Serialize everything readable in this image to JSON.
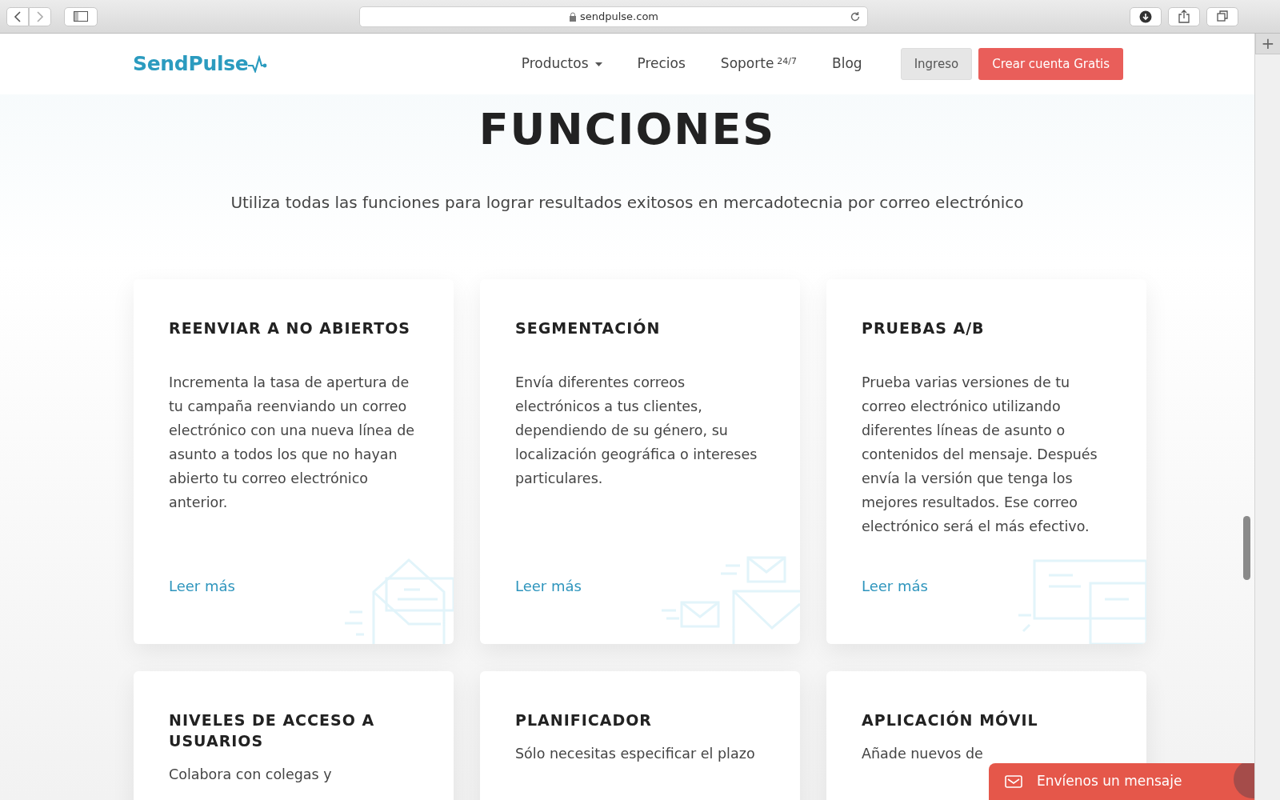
{
  "browser": {
    "url": "sendpulse.com",
    "new_tab": "+"
  },
  "navbar": {
    "logo": "SendPulse",
    "items": [
      {
        "label": "Productos",
        "kind": "dropdown"
      },
      {
        "label": "Precios",
        "kind": "link"
      },
      {
        "label": "Soporte",
        "sup": "24/7",
        "kind": "link"
      },
      {
        "label": "Blog",
        "kind": "link"
      }
    ],
    "login": "Ingreso",
    "signup": "Crear cuenta Gratis"
  },
  "hero": {
    "title": "FUNCIONES",
    "subtitle": "Utiliza todas las funciones para lograr resultados exitosos en mercadotecnia por correo electrónico"
  },
  "cards": [
    {
      "title": "REENVIAR A NO ABIERTOS",
      "text": "Incrementa la tasa de apertura de tu campaña reenviando un correo electrónico con una nueva línea de asunto a todos los que no hayan abierto tu correo electrónico anterior.",
      "link": "Leer más",
      "kind": "open-envelope"
    },
    {
      "title": "SEGMENTACIÓN",
      "text": "Envía diferentes correos electrónicos a tus clientes, dependiendo de su género, su localización geográfica o intereses particulares.",
      "link": "Leer más",
      "kind": "envelopes"
    },
    {
      "title": "PRUEBAS A/B",
      "text": "Prueba varias versiones de tu correo electrónico utilizando diferentes líneas de asunto o contenidos del mensaje. Después envía la versión que tenga los mejores resultados. Ese correo electrónico será el más efectivo.",
      "link": "Leer más",
      "kind": "ab"
    },
    {
      "title": "NIVELES DE ACCESO A USUARIOS",
      "lines": [
        "Colabora con colegas y"
      ]
    },
    {
      "title": "PLANIFICADOR",
      "lines": [
        "Sólo necesitas especificar el plazo"
      ]
    },
    {
      "title": "APLICACIÓN MÓVIL",
      "lines": [
        "Añade nuevos de"
      ]
    }
  ],
  "chat": {
    "label": "Envíenos un mensaje"
  }
}
